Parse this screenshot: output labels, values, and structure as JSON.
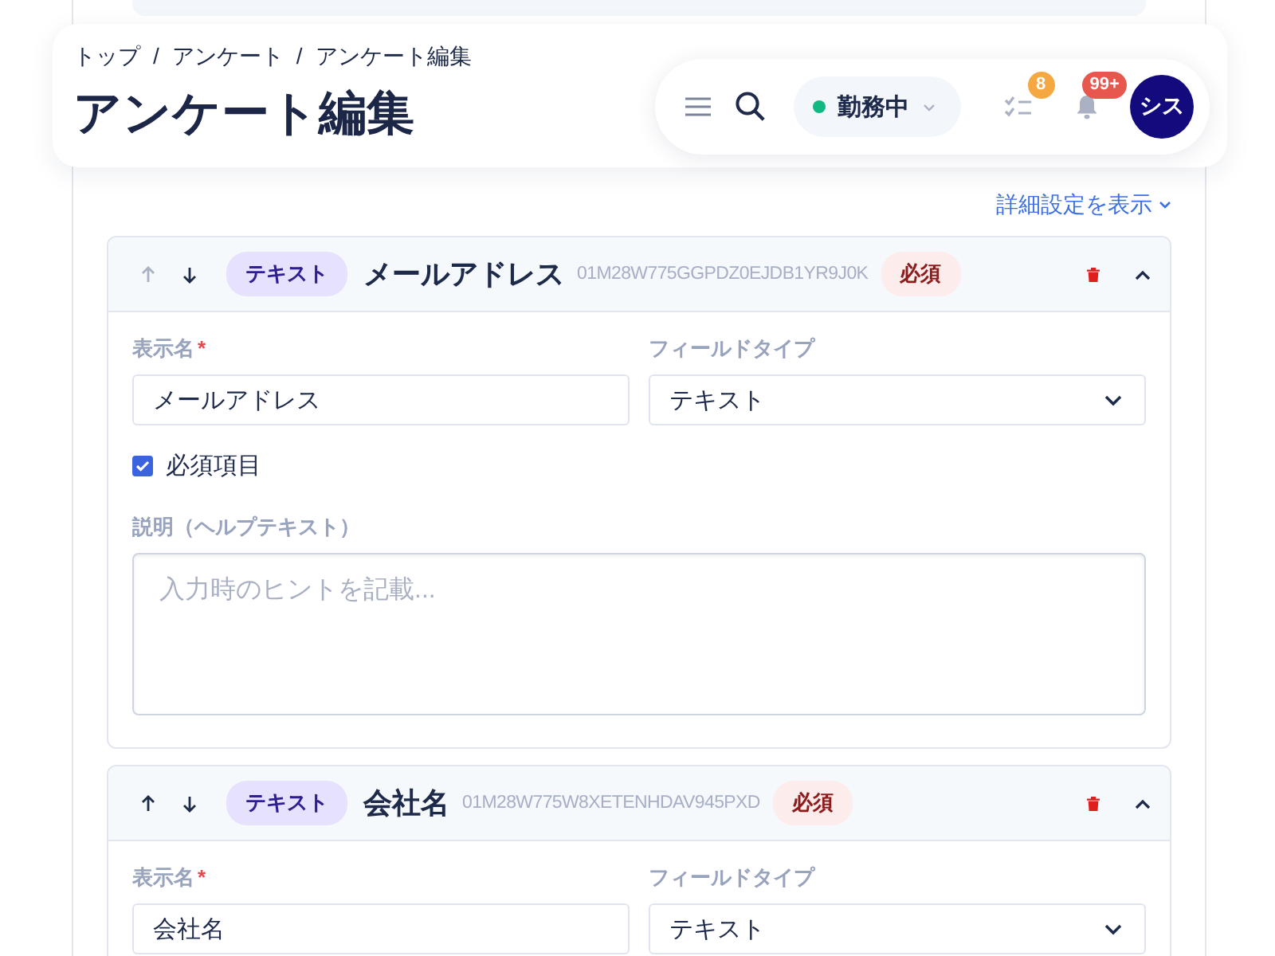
{
  "breadcrumb": [
    "トップ",
    "/",
    "アンケート",
    "/",
    "アンケート編集"
  ],
  "title": "アンケート編集",
  "toolbar": {
    "status": {
      "label": "勤務中",
      "color": "#10b981"
    },
    "tasks_badge": "8",
    "notifications_badge": "99+",
    "avatar": "シス"
  },
  "details_link": "詳細設定を表示",
  "fields": [
    {
      "type_badge": "テキスト",
      "name": "メールアドレス",
      "id": "01M28W775GGPDZ0EJDB1YR9J0K",
      "required_badge": "必須",
      "up_disabled": true,
      "expanded": true,
      "display_name_label": "表示名",
      "required_mark": "*",
      "display_name": "メールアドレス",
      "field_type_label": "フィールドタイプ",
      "field_type": "テキスト",
      "required_checkbox": {
        "label": "必須項目",
        "checked": true
      },
      "help_label": "説明（ヘルプテキスト）",
      "help_placeholder": "入力時のヒントを記載..."
    },
    {
      "type_badge": "テキスト",
      "name": "会社名",
      "id": "01M28W775W8XETENHDAV945PXD",
      "required_badge": "必須",
      "up_disabled": false,
      "expanded": true,
      "display_name_label": "表示名",
      "required_mark": "*",
      "display_name": "会社名",
      "field_type_label": "フィールドタイプ",
      "field_type": "テキスト"
    }
  ]
}
